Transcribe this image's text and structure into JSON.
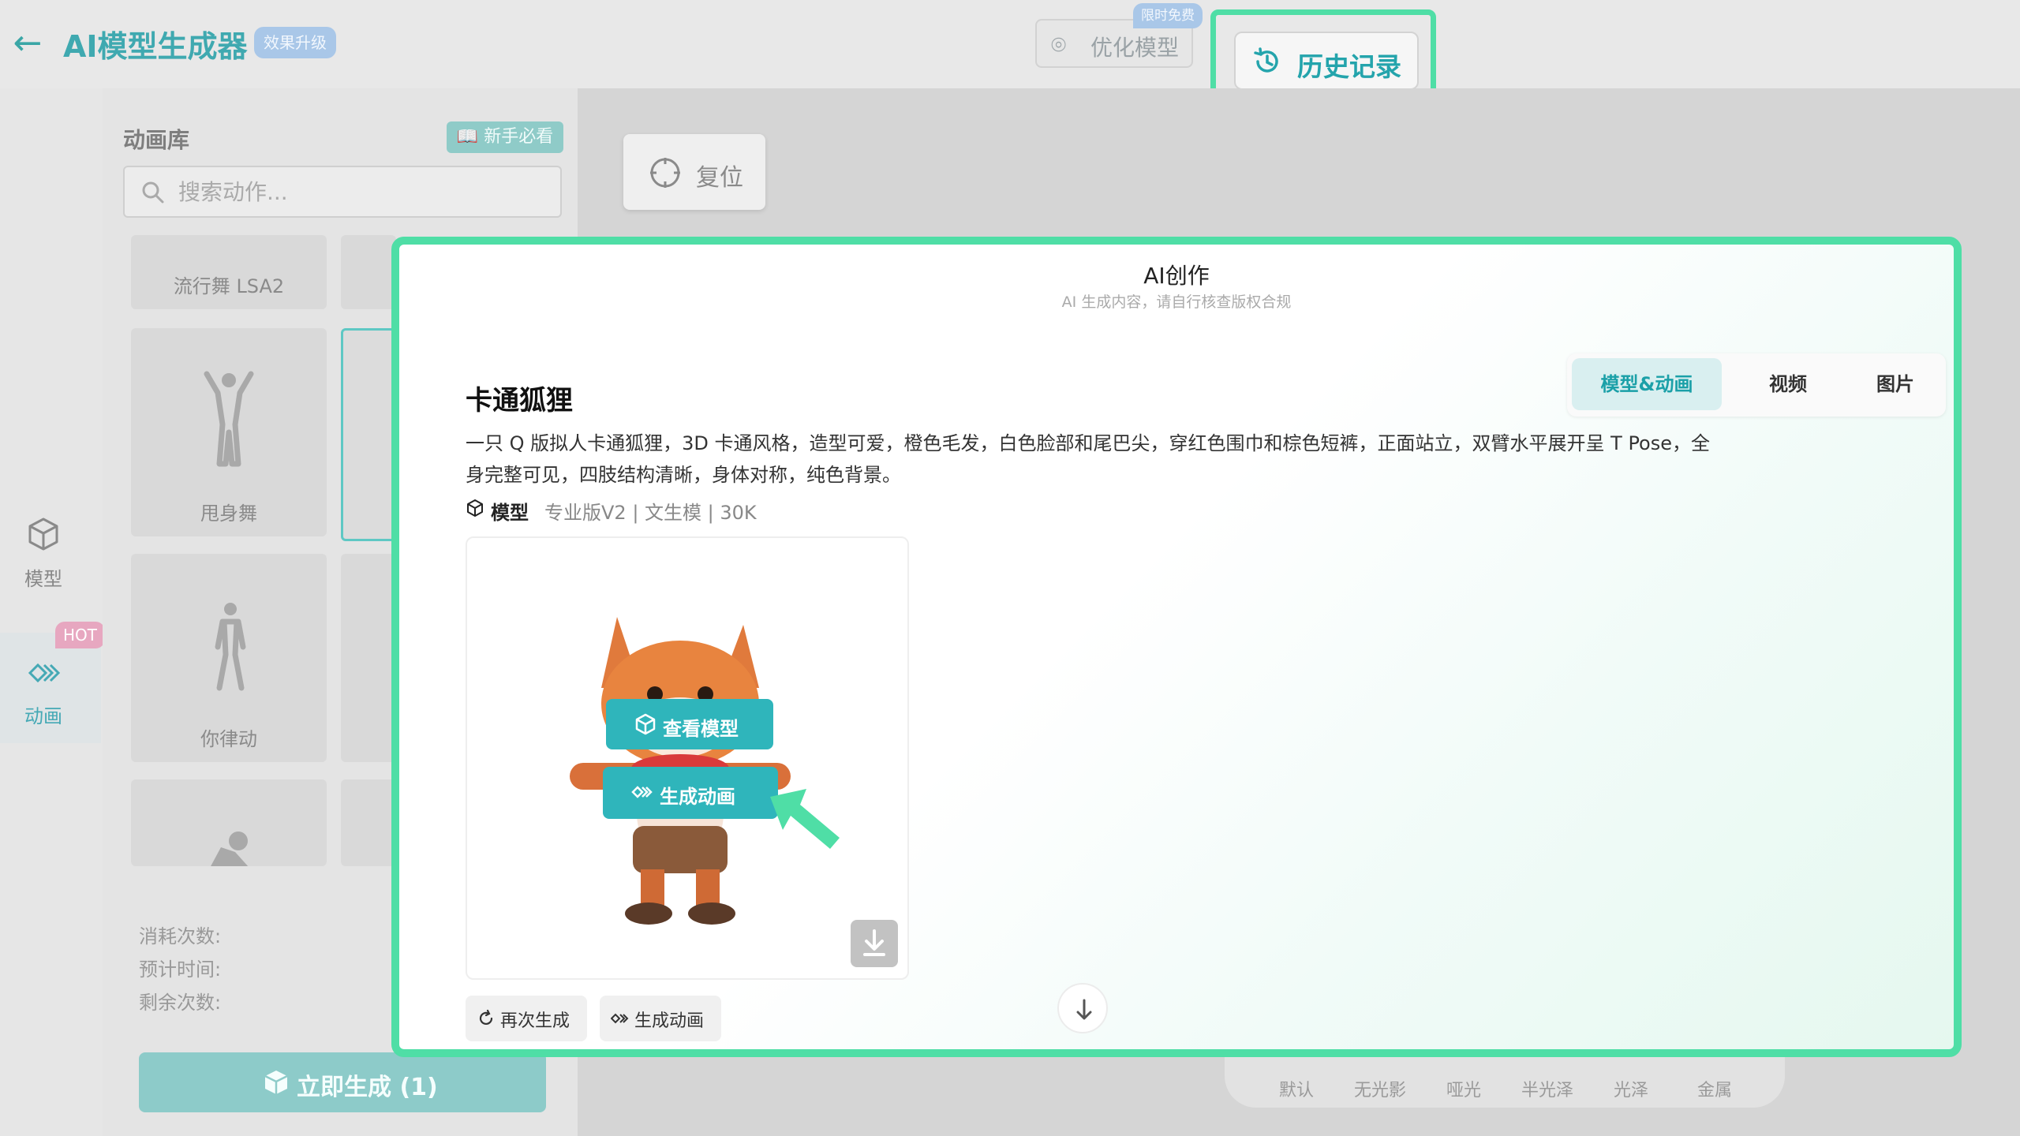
{
  "header": {
    "title": "AI模型生成器",
    "upgrade_badge": "效果升级",
    "optimize_label": "优化模型",
    "free_badge": "限时免费",
    "history_label": "历史记录"
  },
  "nav": {
    "model_label": "模型",
    "anim_label": "动画",
    "hot_badge": "HOT"
  },
  "library": {
    "title": "动画库",
    "guide_label": "新手必看",
    "search_placeholder": "搜索动作...",
    "cards": [
      "流行舞 LSA2",
      "甩身舞",
      "你律动"
    ]
  },
  "generate": {
    "cost_label": "消耗次数:",
    "time_label": "预计时间:",
    "remaining_label": "剩余次数:",
    "button_label": "立即生成 (1)"
  },
  "viewport": {
    "reset_label": "复位",
    "materials": [
      "默认",
      "无光影",
      "哑光",
      "半光泽",
      "光泽",
      "金属"
    ]
  },
  "modal": {
    "title": "AI创作",
    "subtitle": "AI 生成内容，请自行核查版权合规",
    "tabs": [
      "模型&动画",
      "视频",
      "图片"
    ],
    "item_title": "卡通狐狸",
    "item_desc": "一只 Q 版拟人卡通狐狸，3D 卡通风格，造型可爱，橙色毛发，白色脸部和尾巴尖，穿红色围巾和棕色短裤，正面站立，双臂水平展开呈 T Pose，全身完整可见，四肢结构清晰，身体对称，纯色背景。",
    "meta_type": "模型",
    "meta_rest": "专业版V2 | 文生模 | 30K",
    "view_model_label": "查看模型",
    "gen_anim_label": "生成动画",
    "regenerate_label": "再次生成",
    "gen_anim2_label": "生成动画"
  },
  "colors": {
    "accent": "#2fb5bb",
    "highlight": "#4fdea6"
  }
}
